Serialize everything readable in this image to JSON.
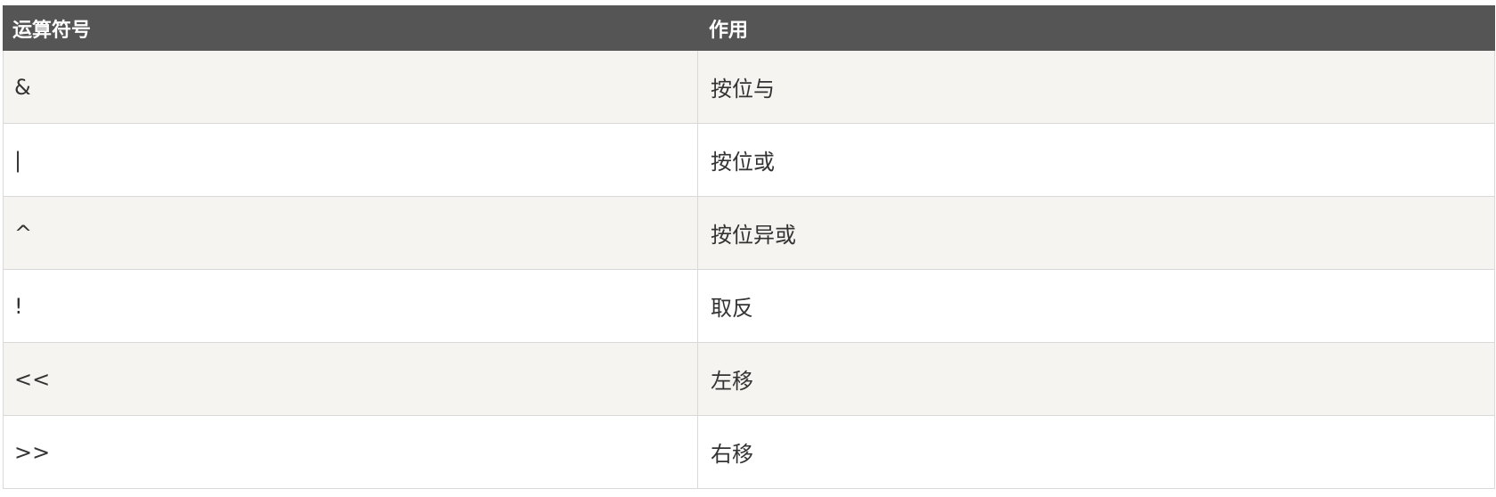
{
  "table": {
    "headers": [
      "运算符号",
      "作用"
    ],
    "rows": [
      {
        "operator": "&",
        "effect": "按位与"
      },
      {
        "operator": "|",
        "effect": "按位或"
      },
      {
        "operator": "^",
        "effect": "按位异或"
      },
      {
        "operator": "!",
        "effect": "取反"
      },
      {
        "operator": "<<",
        "effect": "左移"
      },
      {
        "operator": ">>",
        "effect": "右移"
      }
    ]
  },
  "colors": {
    "header_bg": "#555555",
    "header_text": "#ffffff",
    "row_alt_bg": "#f5f4f1",
    "border": "#d9d9d9"
  }
}
